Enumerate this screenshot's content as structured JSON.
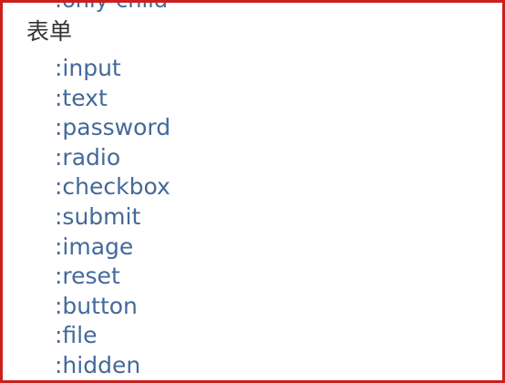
{
  "section": {
    "previous_item_partial": ":only-child",
    "title": "表单",
    "items": [
      ":input",
      ":text",
      ":password",
      ":radio",
      ":checkbox",
      ":submit",
      ":image",
      ":reset",
      ":button",
      ":file",
      ":hidden"
    ]
  },
  "colors": {
    "border": "#cc1f1f",
    "link": "#44699a",
    "heading": "#333333"
  }
}
